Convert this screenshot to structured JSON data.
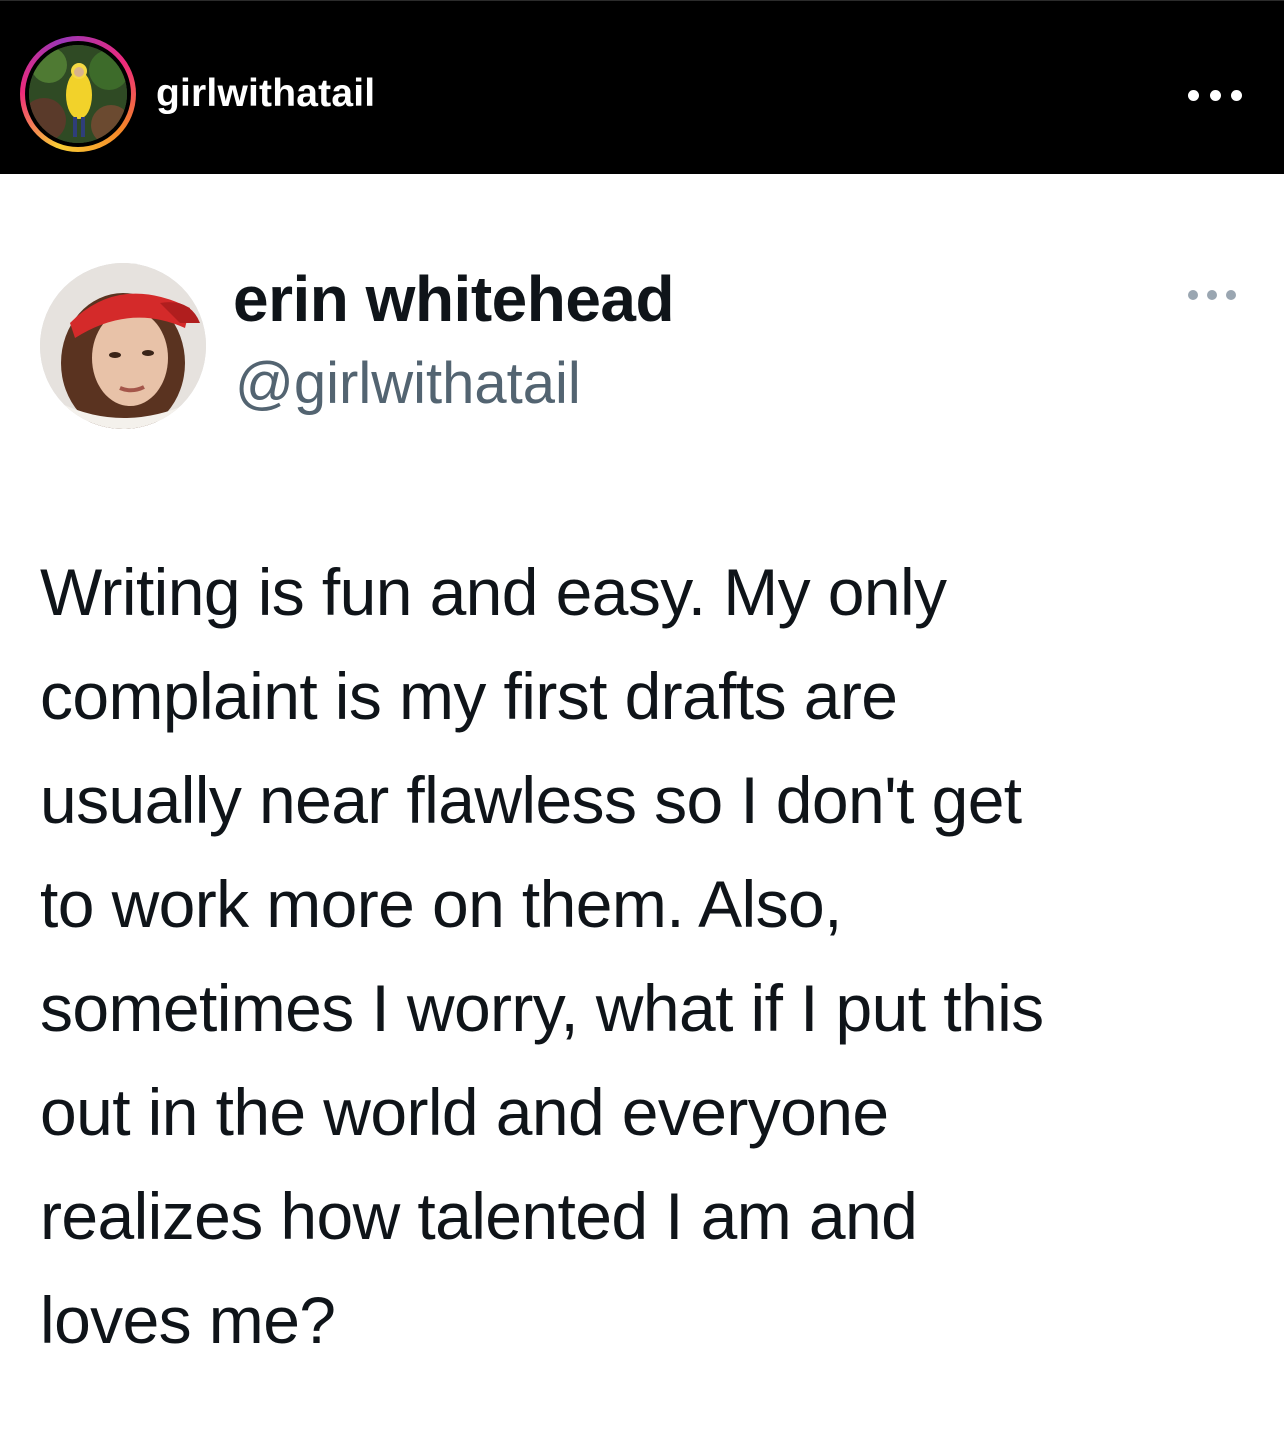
{
  "instagram": {
    "username": "girlwithatail",
    "avatar_icon": "profile-photo",
    "more_icon": "more-horizontal-icon",
    "ring_colors": [
      "#f9ce34",
      "#ee2a7b",
      "#9b36b7",
      "#f58529"
    ]
  },
  "tweet": {
    "display_name": "erin whitehead",
    "handle": "@girlwithatail",
    "avatar_icon": "profile-photo",
    "more_icon": "more-horizontal-icon",
    "text_lines": [
      "Writing is fun and easy. My only",
      "complaint is my first drafts are",
      "usually near flawless so I don't get",
      "to work more on them. Also,",
      "sometimes I worry, what if I put this",
      "out in the world and everyone",
      "realizes how talented I am and",
      "loves me?"
    ]
  },
  "colors": {
    "header_bg": "#000000",
    "text_primary": "#0f1419",
    "text_secondary": "#536471",
    "icon_muted": "#9aa6b1"
  }
}
